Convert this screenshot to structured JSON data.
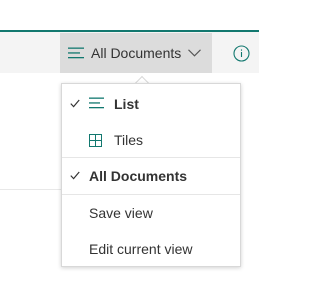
{
  "command_bar": {
    "view_selector_label": "All Documents",
    "icons": {
      "view_lines": "list-lines-icon",
      "dropdown": "chevron-down-icon",
      "info": "info-icon"
    }
  },
  "menu": {
    "items": [
      {
        "label": "List",
        "checked": true,
        "bold": true,
        "icon": "list-lines-icon"
      },
      {
        "label": "Tiles",
        "checked": false,
        "bold": false,
        "icon": "tiles-grid-icon"
      },
      {
        "label": "All Documents",
        "checked": true,
        "bold": true
      },
      {
        "label": "Save view",
        "checked": false,
        "bold": false
      },
      {
        "label": "Edit current view",
        "checked": false,
        "bold": false
      }
    ]
  },
  "colors": {
    "accent": "#12786f",
    "selector_bg": "#dcdcdc",
    "command_bar_bg": "#f4f4f4",
    "text": "#333333"
  }
}
